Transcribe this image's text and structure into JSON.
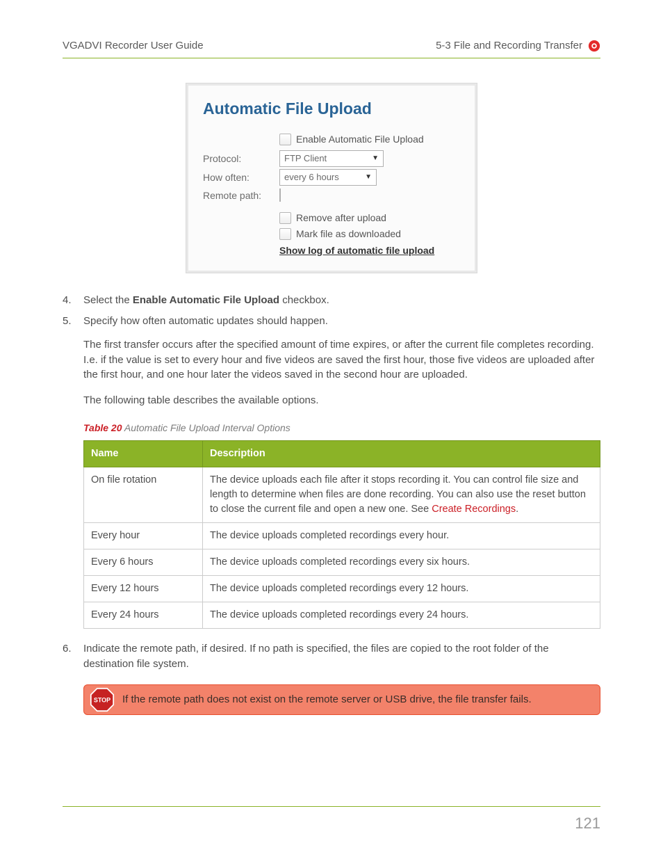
{
  "header": {
    "left": "VGADVI Recorder User Guide",
    "right": "5-3 File and Recording Transfer"
  },
  "panel": {
    "title": "Automatic File Upload",
    "enable_label": "Enable Automatic File Upload",
    "rows": {
      "protocol_label": "Protocol:",
      "protocol_value": "FTP Client",
      "howoften_label": "How often:",
      "howoften_value": "every 6 hours",
      "remotepath_label": "Remote path:",
      "remotepath_value": ""
    },
    "remove_label": "Remove after upload",
    "mark_label": "Mark file as downloaded",
    "log_link": "Show log of automatic file upload"
  },
  "steps": {
    "s4_num": "4.",
    "s4_a": "Select the ",
    "s4_b": "Enable Automatic File Upload",
    "s4_c": " checkbox.",
    "s5_num": "5.",
    "s5": "Specify how often automatic updates should happen.",
    "s5_p1": "The first transfer occurs after the specified amount of time expires, or after the current file completes recording. I.e. if the value is set to every hour and five videos are saved the first hour, those five videos are uploaded after the first hour, and one hour later the videos saved in the second hour are uploaded.",
    "s5_p2": "The following table describes the available options.",
    "s6_num": "6.",
    "s6": "Indicate the remote path, if desired. If no path is specified, the files are copied to the root folder of the destination file system."
  },
  "table": {
    "caption_prefix": "Table 20",
    "caption_text": " Automatic File Upload Interval Options",
    "head_name": "Name",
    "head_desc": "Description",
    "rows": [
      {
        "name": "On file rotation",
        "desc_a": "The device uploads each file after it stops recording it. You can control file size and length to determine when files are done recording. You can also use the reset button to close the current file and open a new one. See ",
        "desc_link": "Create Recordings",
        "desc_b": "."
      },
      {
        "name": "Every hour",
        "desc_a": "The device uploads completed recordings every hour.",
        "desc_link": "",
        "desc_b": ""
      },
      {
        "name": "Every 6 hours",
        "desc_a": "The device uploads completed recordings every six hours.",
        "desc_link": "",
        "desc_b": ""
      },
      {
        "name": "Every 12 hours",
        "desc_a": "The device uploads completed recordings every 12 hours.",
        "desc_link": "",
        "desc_b": ""
      },
      {
        "name": "Every 24 hours",
        "desc_a": "The device uploads completed recordings every 24 hours.",
        "desc_link": "",
        "desc_b": ""
      }
    ]
  },
  "stop": {
    "label": "STOP",
    "text": "If the remote path does not exist on the remote server or USB drive, the file transfer fails."
  },
  "page_number": "121"
}
